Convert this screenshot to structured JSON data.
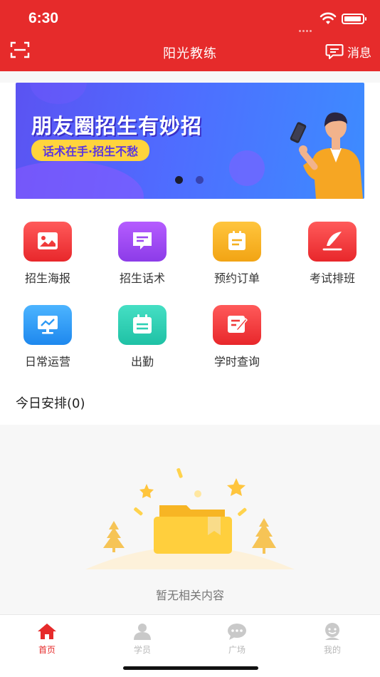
{
  "status_bar": {
    "time": "6:30"
  },
  "header": {
    "title": "阳光教练",
    "message_label": "消息"
  },
  "banner": {
    "title": "朋友圈招生有妙招",
    "subtitle": "话术在手·招生不愁",
    "page_count": 2,
    "active_page": 1
  },
  "features": [
    {
      "label": "招生海报",
      "icon": "poster-icon",
      "color": "#f03a3a"
    },
    {
      "label": "招生话术",
      "icon": "chat-script-icon",
      "color": "#a04cf0"
    },
    {
      "label": "预约订单",
      "icon": "order-icon",
      "color": "#f4b020"
    },
    {
      "label": "考试排班",
      "icon": "feather-icon",
      "color": "#f03a3a"
    },
    {
      "label": "日常运营",
      "icon": "monitor-chart-icon",
      "color": "#2e9af5"
    },
    {
      "label": "出勤",
      "icon": "calendar-icon",
      "color": "#2cd0b4"
    },
    {
      "label": "学时查询",
      "icon": "edit-form-icon",
      "color": "#f03a3a"
    }
  ],
  "schedule": {
    "title": "今日安排(0)"
  },
  "empty_state": {
    "text": "暂无相关内容"
  },
  "tabbar": {
    "items": [
      {
        "label": "首页",
        "icon": "home-icon",
        "active": true
      },
      {
        "label": "学员",
        "icon": "student-icon",
        "active": false
      },
      {
        "label": "广场",
        "icon": "square-chat-icon",
        "active": false
      },
      {
        "label": "我的",
        "icon": "profile-icon",
        "active": false
      }
    ]
  },
  "colors": {
    "brand_red": "#e62b2b",
    "inactive_tab": "#b8b8b8"
  }
}
